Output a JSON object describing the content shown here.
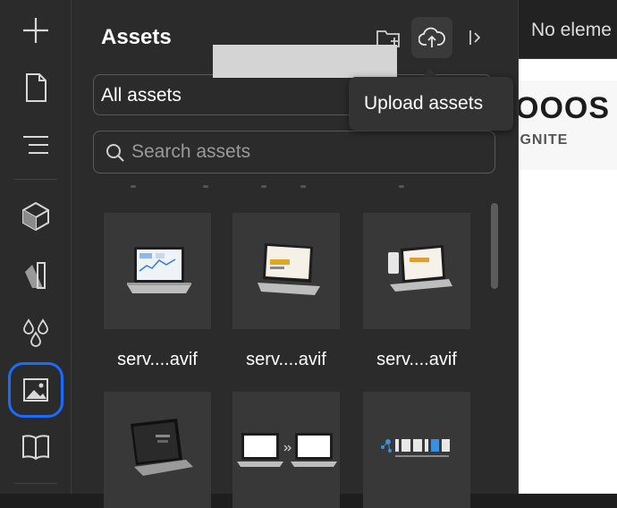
{
  "rail": {
    "items": [
      {
        "icon": "plus-icon"
      },
      {
        "icon": "page-icon"
      },
      {
        "icon": "navigator-icon"
      },
      {
        "icon": "components-cube-icon"
      },
      {
        "icon": "styles-icon"
      },
      {
        "icon": "variables-drops-icon"
      },
      {
        "icon": "assets-image-icon",
        "active": true
      },
      {
        "icon": "cms-book-icon"
      }
    ]
  },
  "panel": {
    "title": "Assets",
    "filter_value": "All assets",
    "search_placeholder": "Search assets",
    "tooltip": "Upload assets"
  },
  "assets": [
    {
      "name": "serv....avif",
      "thumb": "laptop-dashboard"
    },
    {
      "name": "serv....avif",
      "thumb": "laptop-boost"
    },
    {
      "name": "serv....avif",
      "thumb": "laptop-phone"
    },
    {
      "name": "",
      "thumb": "laptop-dark"
    },
    {
      "name": "",
      "thumb": "laptop-pair"
    },
    {
      "name": "",
      "thumb": "ignite-logo"
    }
  ],
  "right": {
    "selection_text": "No eleme",
    "brand_text": "OOOS",
    "brand_sub": "IGNITE"
  },
  "colors": {
    "accent": "#1a6cff",
    "panel_bg": "#2b2b2b",
    "tile_bg": "#383838"
  }
}
